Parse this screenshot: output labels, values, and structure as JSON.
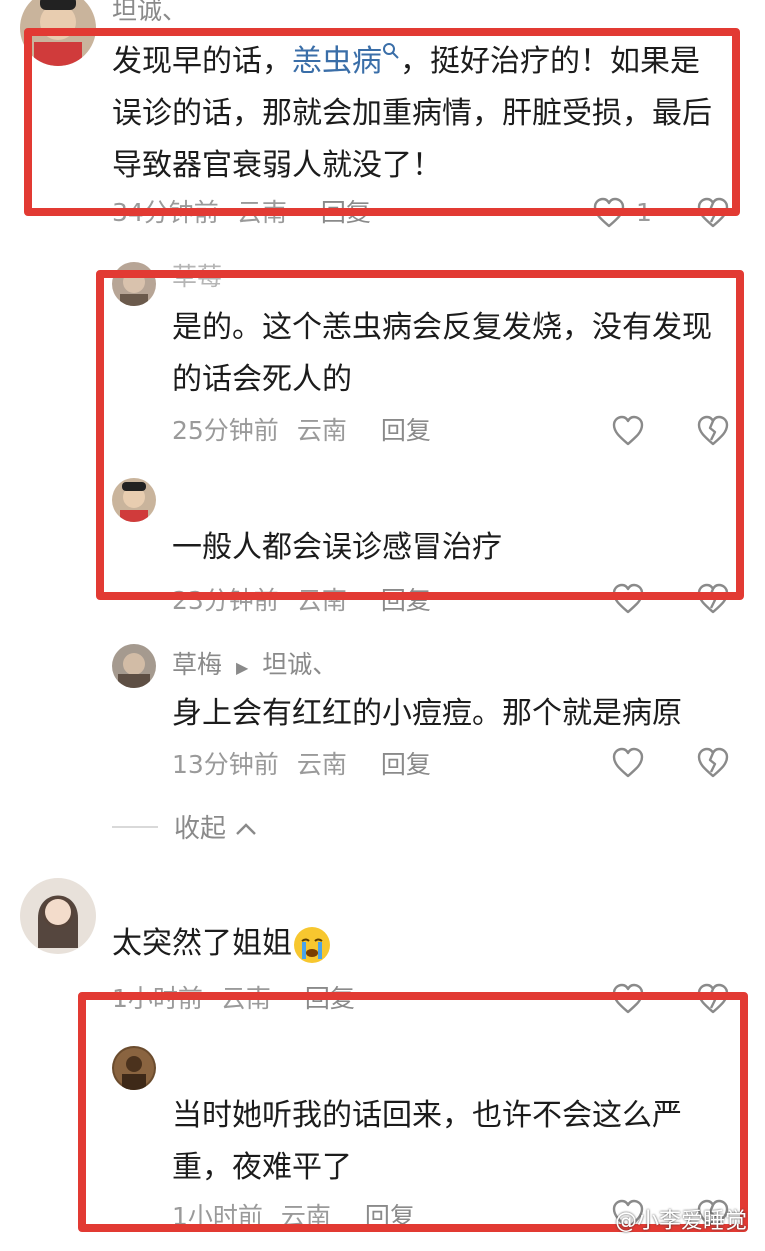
{
  "comments": [
    {
      "username": "坦诚、",
      "text_pre": "发现早的话，",
      "topic": "恙虫病",
      "text_post": "，挺好治疗的！如果是误诊的话，那就会加重病情，肝脏受损，最后导致器官衰弱人就没了！",
      "time": "34分钟前",
      "location": "云南",
      "reply": "回复",
      "likes": "1"
    },
    {
      "username": "草莓",
      "text": "是的。这个恙虫病会反复发烧，没有发现的话会死人的",
      "time": "25分钟前",
      "location": "云南",
      "reply": "回复"
    },
    {
      "text": "一般人都会误诊感冒治疗",
      "time": "23分钟前",
      "location": "云南",
      "reply": "回复"
    },
    {
      "username": "草梅",
      "reply_to": "坦诚、",
      "text": "身上会有红红的小痘痘。那个就是病原",
      "time": "13分钟前",
      "location": "云南",
      "reply": "回复"
    },
    {
      "text": "太突然了姐姐",
      "time": "1小时前",
      "location": "云南",
      "reply": "回复"
    },
    {
      "text": "当时她听我的话回来，也许不会这么严重，夜难平了",
      "time": "1小时前",
      "location": "云南",
      "reply": "回复"
    }
  ],
  "collapse_label": "收起",
  "watermark": "@小李爱睡觉",
  "colors": {
    "highlight_box": "#e23a33",
    "topic_link": "#3a6ea8",
    "meta": "#9a9a9a"
  },
  "icons": [
    "heart-icon",
    "broken-heart-icon",
    "search-icon",
    "chevron-up-icon",
    "crying-emoji-icon"
  ]
}
